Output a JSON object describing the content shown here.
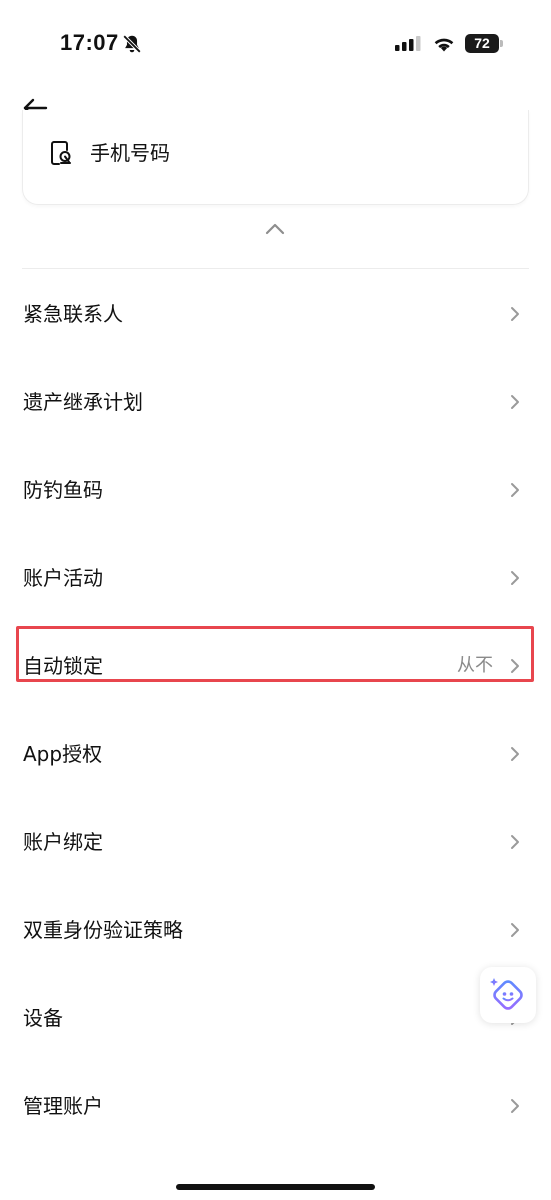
{
  "status_bar": {
    "time": "17:07",
    "battery_level": "72",
    "icons": [
      "bell-off-icon",
      "signal-icon",
      "wifi-icon",
      "battery-icon"
    ]
  },
  "header": {
    "back_icon": "arrow-left-icon"
  },
  "phone_card": {
    "label": "手机号码",
    "icon": "phone-icon"
  },
  "collapse_icon": "chevron-up-icon",
  "menu": {
    "items": [
      {
        "label": "紧急联系人",
        "value": ""
      },
      {
        "label": "遗产继承计划",
        "value": ""
      },
      {
        "label": "防钓鱼码",
        "value": ""
      },
      {
        "label": "账户活动",
        "value": ""
      },
      {
        "label": "自动锁定",
        "value": "从不",
        "highlighted": true
      },
      {
        "label": "App授权",
        "value": ""
      },
      {
        "label": "账户绑定",
        "value": ""
      },
      {
        "label": "双重身份验证策略",
        "value": ""
      },
      {
        "label": "设备",
        "value": ""
      },
      {
        "label": "管理账户",
        "value": ""
      }
    ]
  },
  "assistant": {
    "icon": "sparkle-face-icon"
  },
  "colors": {
    "highlight": "#e8464e",
    "text": "#111111",
    "secondary_text": "#8a8a8a",
    "chevron": "#9a9a9a",
    "assistant_gradient": [
      "#5b8cff",
      "#9b6bff"
    ]
  }
}
